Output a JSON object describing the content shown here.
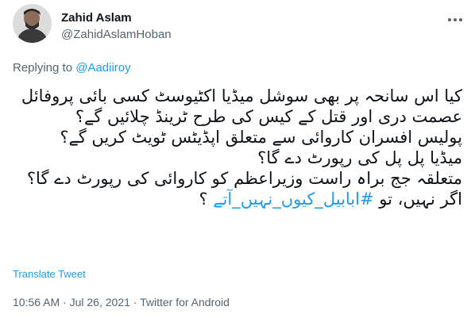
{
  "author": {
    "name": "Zahid Aslam",
    "handle": "@ZahidAslamHoban"
  },
  "reply": {
    "prefix": "Replying to",
    "to_handle": "@Aadiiroy"
  },
  "tweet": {
    "lines": [
      "کیا اس سانحہ پر بھی سوشل میڈیا اکٹیوسٹ کسی بائی پروفائل عصمت دری اور قتل کے کیس کی طرح ٹرینڈ چلائیں گے؟",
      "پولیس افسران کاروائی سے متعلق اپڈیٹس ٹویٹ کریں گے؟",
      "میڈیا پل پل کی رپورٹ دے گا؟",
      "متعلقہ جج براہ راست وزیراعظم کو کاروائی کی رپورٹ دے گا؟"
    ],
    "last_line_prefix": "اگر نہیں، تو",
    "hashtag": "#ابابیل_کیوں_نہیں_آتے",
    "last_line_suffix": " ؟"
  },
  "translate_label": "Translate Tweet",
  "meta": {
    "time": "10:56 AM",
    "date": "Jul 26, 2021",
    "source": "Twitter for Android"
  },
  "icons": {
    "more": "more-options-icon",
    "avatar": "avatar-photo"
  }
}
